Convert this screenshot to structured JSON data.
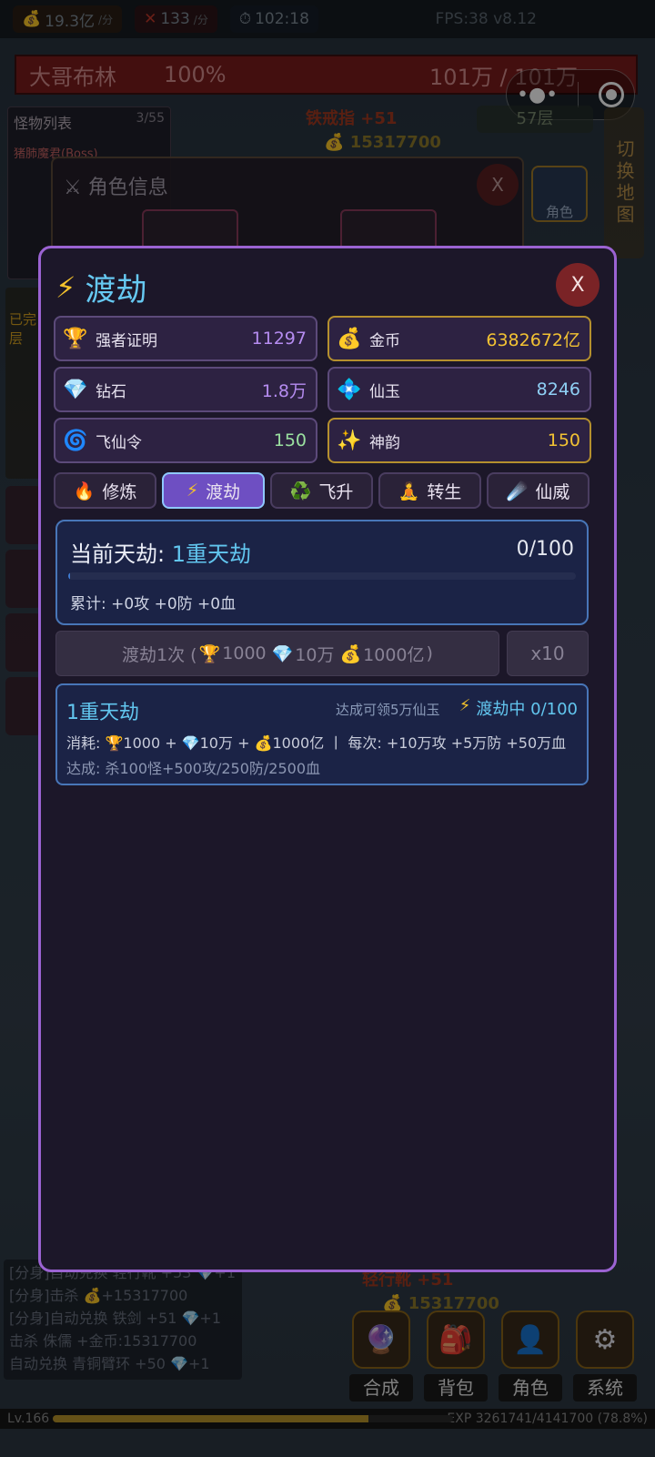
{
  "topbar": {
    "gold_rate": "19.3亿",
    "gold_rate_unit": "/分",
    "kill_rate": "133",
    "kill_rate_unit": "/分",
    "timer": "102:18",
    "fps": "FPS:38 v8.12"
  },
  "boss": {
    "name": "大哥布林",
    "percent": "100%",
    "hp": "101万 / 101万"
  },
  "monster_list": {
    "title": "怪物列表",
    "count": "3/55",
    "first_item": "猪肺魔君(Boss)"
  },
  "left_panel": {
    "lines": [
      "已完",
      "层"
    ]
  },
  "floor_label": "57层",
  "map_switch": "切换地图",
  "floating": {
    "loot_top": "铁戒指 +51",
    "gold_top": "15317700",
    "loot_bottom": "轻行靴 +51",
    "gold_bottom": "15317700"
  },
  "role_info": {
    "title": "角色信息",
    "close": "X",
    "role_button": "角色"
  },
  "log": [
    "[分身]自动兑换 轻行靴 +53 💎+1",
    "[分身]击杀 💰+15317700",
    "[分身]自动兑换 铁剑 +51 💎+1",
    "击杀 侏儒 +金币:15317700",
    "自动兑换 青铜臂环 +50 💎+1"
  ],
  "bottom_nav": [
    {
      "label": "合成",
      "icon": "crystal-ball-icon",
      "glyph": "🔮"
    },
    {
      "label": "背包",
      "icon": "backpack-icon",
      "glyph": "🎒"
    },
    {
      "label": "角色",
      "icon": "character-icon",
      "glyph": "👤"
    },
    {
      "label": "系统",
      "icon": "gear-icon",
      "glyph": "⚙"
    }
  ],
  "exp": {
    "level": "Lv.166",
    "text": "EXP 3261741/4141700 (78.8%)",
    "fraction": 0.788
  },
  "modal": {
    "title": "渡劫",
    "close": "X",
    "resources": [
      {
        "icon": "trophy-icon",
        "glyph": "🏆",
        "name": "强者证明",
        "value": "11297",
        "color": "#b58cf0"
      },
      {
        "icon": "money-bag-icon",
        "glyph": "💰",
        "name": "金币",
        "value": "6382672亿",
        "color": "#f2c233"
      },
      {
        "icon": "diamond-icon",
        "glyph": "💎",
        "name": "钻石",
        "value": "1.8万",
        "color": "#b58cf0"
      },
      {
        "icon": "jade-icon",
        "glyph": "💠",
        "name": "仙玉",
        "value": "8246",
        "color": "#8fd0f5"
      },
      {
        "icon": "vortex-icon",
        "glyph": "🌀",
        "name": "飞仙令",
        "value": "150",
        "color": "#9ae0a0"
      },
      {
        "icon": "sparkles-icon",
        "glyph": "✨",
        "name": "神韵",
        "value": "150",
        "color": "#f2c233"
      }
    ],
    "tabs": [
      {
        "glyph": "🔥",
        "icon": "fire-icon",
        "label": "修炼",
        "active": false
      },
      {
        "glyph": "⚡",
        "icon": "lightning-icon",
        "label": "渡劫",
        "active": true
      },
      {
        "glyph": "♻️",
        "icon": "recycle-icon",
        "label": "飞升",
        "active": false
      },
      {
        "glyph": "🧘",
        "icon": "meditation-icon",
        "label": "转生",
        "active": false
      },
      {
        "glyph": "☄️",
        "icon": "comet-icon",
        "label": "仙威",
        "active": false
      }
    ],
    "current": {
      "label": "当前天劫:",
      "name": "1重天劫",
      "progress_text": "0/100",
      "progress": 0,
      "accum": "累计: +0攻 +0防 +0血"
    },
    "cross_button": {
      "prefix": "渡劫1次 (",
      "cost1": "1000",
      "cost2": "10万",
      "cost3": "1000亿",
      "suffix": ")"
    },
    "x10_button": "x10",
    "stage": {
      "name": "1重天劫",
      "reward": "达成可领5万仙玉",
      "status": "渡劫中 0/100",
      "cost": "消耗: 🏆1000 + 💎10万 + 💰1000亿 丨 每次: +10万攻 +5万防 +50万血",
      "requirement": "达成: 杀100怪+500攻/250防/2500血"
    }
  }
}
